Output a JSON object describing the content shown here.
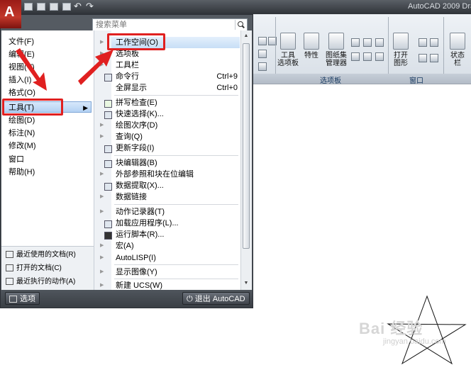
{
  "titlebar": {
    "title": "AutoCAD 2009  Dra"
  },
  "ribbon": {
    "buttons": [
      {
        "label": "工具\n选项板"
      },
      {
        "label": "特性"
      },
      {
        "label": "图纸集\n管理器"
      },
      {
        "label": "打开\n图形"
      },
      {
        "label": "状态\n栏"
      }
    ],
    "panels": [
      {
        "title": "选项板"
      },
      {
        "title": "窗口"
      }
    ]
  },
  "search": {
    "placeholder": "搜索菜单"
  },
  "main_menu": {
    "items": [
      {
        "label": "文件(F)"
      },
      {
        "label": "编辑(E)"
      },
      {
        "label": "视图(V)"
      },
      {
        "label": "插入(I)"
      },
      {
        "label": "格式(O)"
      },
      {
        "label": "工具(T)",
        "highlighted": true
      },
      {
        "label": "绘图(D)"
      },
      {
        "label": "标注(N)"
      },
      {
        "label": "修改(M)"
      },
      {
        "label": "窗口"
      },
      {
        "label": "帮助(H)"
      }
    ],
    "recent": [
      {
        "label": "最近使用的文档(R)"
      },
      {
        "label": "打开的文档(C)"
      },
      {
        "label": "最近执行的动作(A)"
      }
    ]
  },
  "tools_submenu": {
    "items": [
      {
        "label": "工作空间(O)",
        "submenu": true,
        "highlighted": true
      },
      {
        "label": "选项板",
        "submenu": true
      },
      {
        "label": "工具栏",
        "submenu": true
      },
      {
        "label": "命令行",
        "shortcut": "Ctrl+9",
        "icon": "command-line-icon"
      },
      {
        "label": "全屏显示",
        "shortcut": "Ctrl+0"
      },
      {
        "label": "拼写检查(E)",
        "icon": "spell-check-icon"
      },
      {
        "label": "快速选择(K)...",
        "icon": "quick-select-icon"
      },
      {
        "label": "绘图次序(D)",
        "submenu": true
      },
      {
        "label": "查询(Q)",
        "submenu": true
      },
      {
        "label": "更新字段(I)",
        "icon": "update-field-icon"
      },
      {
        "label": "块编辑器(B)",
        "icon": "block-editor-icon"
      },
      {
        "label": "外部参照和块在位编辑",
        "submenu": true
      },
      {
        "label": "数据提取(X)...",
        "icon": "data-extraction-icon"
      },
      {
        "label": "数据链接",
        "submenu": true
      },
      {
        "label": "动作记录器(T)",
        "submenu": true
      },
      {
        "label": "加载应用程序(L)...",
        "icon": "load-app-icon"
      },
      {
        "label": "运行脚本(R)...",
        "icon": "run-script-icon"
      },
      {
        "label": "宏(A)",
        "submenu": true
      },
      {
        "label": "AutoLISP(I)",
        "submenu": true
      },
      {
        "label": "显示图像(Y)",
        "submenu": true
      },
      {
        "label": "新建 UCS(W)",
        "submenu": true
      }
    ]
  },
  "footer": {
    "options_label": "选项",
    "exit_label": "退出 AutoCAD"
  },
  "watermark": {
    "brand": "Bai 经验",
    "url": "jingyan.baidu.com"
  },
  "colors": {
    "annotation_red": "#e02020",
    "menu_dark": "#555b62",
    "highlight": "#c7def6"
  }
}
